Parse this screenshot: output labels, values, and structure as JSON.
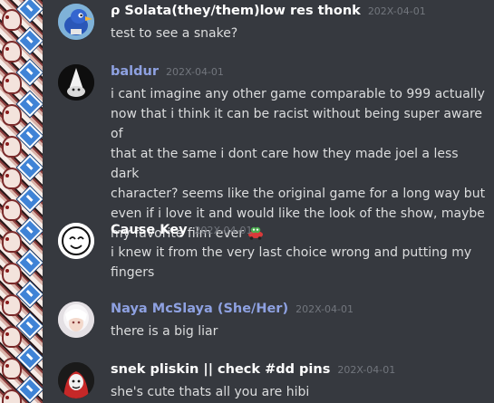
{
  "messages": [
    {
      "username": "ρ Solata(they/them)low res thonk",
      "timestamp": "202X-04-01",
      "lines": [
        "test to see a snake?"
      ],
      "avatar_icon": "blue-bird-avatar"
    },
    {
      "username": "baldur",
      "timestamp": "202X-04-01",
      "lines": [
        "i cant imagine any other game comparable to 999 actually",
        "now that i think it can be racist without being super aware of",
        "that at the same i dont care how they made joel a less dark",
        "character? seems like the original game for a long way but",
        "even if i love it and would like the look of the show, maybe",
        "my favorite film ever"
      ],
      "emoji": "frog-car-emoji",
      "avatar_icon": "gnome-hat-avatar"
    },
    {
      "username": "Cause Key",
      "timestamp": "202X-04-01",
      "lines": [
        "i knew it from the very last choice wrong and putting my",
        "fingers"
      ],
      "avatar_icon": "hand-drawn-face-avatar"
    },
    {
      "username": "Naya McSlaya (She/Her)",
      "timestamp": "202X-04-01",
      "lines": [
        "there is a big liar"
      ],
      "avatar_icon": "white-haired-anime-avatar"
    },
    {
      "username": "snek pliskin || check #dd pins",
      "timestamp": "202X-04-01",
      "lines": [
        "she's cute thats all you are hibi"
      ],
      "avatar_icon": "red-hooded-character-avatar"
    }
  ],
  "colors": {
    "background": "#36393f",
    "username_default": "#ffffff",
    "username_blurple": "#8ea1e1",
    "timestamp": "#72767d",
    "message_text": "#dcddde"
  }
}
